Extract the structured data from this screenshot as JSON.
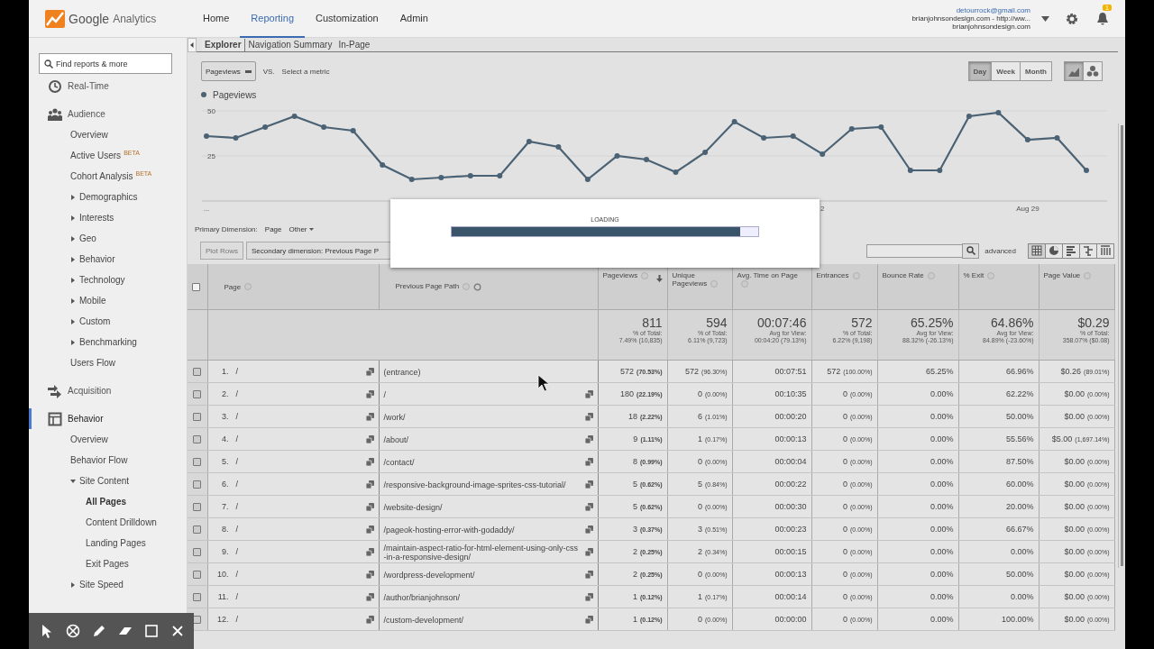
{
  "header": {
    "logo": {
      "brand": "Google",
      "product": "Analytics"
    },
    "nav": [
      {
        "label": "Home",
        "selected": false
      },
      {
        "label": "Reporting",
        "selected": true
      },
      {
        "label": "Customization",
        "selected": false
      },
      {
        "label": "Admin",
        "selected": false
      }
    ],
    "account": {
      "email": "detourrock@gmail.com",
      "property": "brianjohnsondesign.com - http://ww...",
      "view": "brianjohnsondesign.com"
    },
    "notifications": "1"
  },
  "sidebar": {
    "search": {
      "placeholder": "Find reports & more"
    },
    "sections": [
      {
        "label": "Real-Time",
        "kind": "realtime",
        "selected": false
      },
      {
        "label": "Audience",
        "kind": "audience",
        "selected": false,
        "items": [
          {
            "label": "Overview",
            "selected": false
          },
          {
            "label": "Active Users",
            "badge": "BETA",
            "selected": false
          },
          {
            "label": "Cohort Analysis",
            "badge": "BETA",
            "selected": false
          },
          {
            "label": "Demographics",
            "expanded": false,
            "selected": false
          },
          {
            "label": "Interests",
            "expanded": false,
            "selected": false
          },
          {
            "label": "Geo",
            "expanded": false,
            "selected": false
          },
          {
            "label": "Behavior",
            "expanded": false,
            "selected": false
          },
          {
            "label": "Technology",
            "expanded": false,
            "selected": false
          },
          {
            "label": "Mobile",
            "expanded": false,
            "selected": false
          },
          {
            "label": "Custom",
            "expanded": false,
            "selected": false
          },
          {
            "label": "Benchmarking",
            "expanded": false,
            "selected": false
          },
          {
            "label": "Users Flow",
            "selected": false
          }
        ]
      },
      {
        "label": "Acquisition",
        "kind": "acquisition",
        "selected": false
      },
      {
        "label": "Behavior",
        "kind": "behavior",
        "selected": true,
        "items": [
          {
            "label": "Overview",
            "selected": false
          },
          {
            "label": "Behavior Flow",
            "selected": false
          },
          {
            "label": "Site Content",
            "expanded": true,
            "selected": false,
            "children": [
              {
                "label": "All Pages",
                "selected": true
              },
              {
                "label": "Content Drilldown",
                "selected": false
              },
              {
                "label": "Landing Pages",
                "selected": false
              },
              {
                "label": "Exit Pages",
                "selected": false
              }
            ]
          },
          {
            "label": "Site Speed",
            "expanded": false,
            "selected": false
          }
        ]
      }
    ]
  },
  "report": {
    "tabs": [
      {
        "label": "Explorer",
        "selected": true
      },
      {
        "label": "Navigation Summary",
        "selected": false
      },
      {
        "label": "In-Page",
        "selected": false
      }
    ],
    "metric": {
      "primary": "Pageviews",
      "vs": "VS.",
      "secondary": "Select a metric"
    },
    "periods": [
      {
        "label": "Day",
        "selected": true
      },
      {
        "label": "Week",
        "selected": false
      },
      {
        "label": "Month",
        "selected": false
      }
    ],
    "chart_types": [
      {
        "kind": "line",
        "selected": true
      },
      {
        "kind": "motion",
        "selected": false
      }
    ],
    "chart_data": {
      "type": "line",
      "yticks": [
        25,
        50
      ],
      "ylim": [
        0,
        50
      ],
      "categories": [
        "...",
        null,
        null,
        null,
        null,
        null,
        null,
        null,
        null,
        null,
        null,
        null,
        null,
        null,
        null,
        null,
        null,
        null,
        null,
        null,
        null,
        "2",
        null,
        null,
        null,
        null,
        null,
        null,
        "Aug 29",
        null,
        null
      ],
      "series": [
        {
          "name": "Pageviews",
          "color": "#4a6274",
          "marker": "circle",
          "values": [
            36,
            35,
            41,
            47,
            41,
            39,
            20,
            12,
            13,
            14,
            14,
            33,
            30,
            12,
            25,
            23,
            16,
            27,
            44,
            35,
            36,
            26,
            40,
            41,
            17,
            17,
            47,
            49,
            34,
            35,
            17
          ]
        }
      ]
    },
    "loading": {
      "label": "LOADING",
      "level": 0.94
    },
    "dimension": {
      "label": "Primary Dimension:",
      "value": "Page",
      "other": "Other"
    },
    "plot_rows": "Plot Rows",
    "secondary_dimension": "Secondary dimension: Previous Page P",
    "advanced": "advanced",
    "views": [
      {
        "kind": "table",
        "selected": true
      },
      {
        "kind": "pie",
        "selected": false
      },
      {
        "kind": "performance",
        "selected": false
      },
      {
        "kind": "comparison",
        "selected": false
      },
      {
        "kind": "pivot",
        "selected": false
      }
    ],
    "table": {
      "select_all": {
        "checked": false
      },
      "columns": [
        {
          "label": "Page"
        },
        {
          "label": "Previous Page Path"
        },
        {
          "label": "Pageviews",
          "sorted": true
        },
        {
          "label": "Unique Pageviews"
        },
        {
          "label": "Avg. Time on Page"
        },
        {
          "label": "Entrances"
        },
        {
          "label": "Bounce Rate"
        },
        {
          "label": "% Exit"
        },
        {
          "label": "Page Value"
        }
      ],
      "totals": [
        {
          "value": "811",
          "caption": "% of Total:",
          "detail": "7.49% (10,835)"
        },
        {
          "value": "594",
          "caption": "% of Total:",
          "detail": "6.11% (9,723)"
        },
        {
          "value": "00:07:46",
          "caption": "Avg for View:",
          "detail": "00:04:20 (79.13%)"
        },
        {
          "value": "572",
          "caption": "% of Total:",
          "detail": "6.22% (9,198)"
        },
        {
          "value": "65.25%",
          "caption": "Avg for View:",
          "detail": "88.32% (-26.13%)"
        },
        {
          "value": "64.86%",
          "caption": "Avg for View:",
          "detail": "84.89% (-23.60%)"
        },
        {
          "value": "$0.29",
          "caption": "% of Total:",
          "detail": "358.07% ($0.08)"
        }
      ],
      "rows": [
        {
          "checked": false,
          "index": "1.",
          "page": "/",
          "previous": "(entrance)",
          "previous_link": false,
          "metrics": [
            [
              "572",
              "(70.53%)"
            ],
            [
              "572",
              "(96.30%)"
            ],
            [
              "00:07:51"
            ],
            [
              "572",
              "(100.00%)"
            ],
            [
              "65.25%"
            ],
            [
              "66.96%"
            ],
            [
              "$0.26",
              "(89.01%)"
            ]
          ]
        },
        {
          "checked": false,
          "index": "2.",
          "page": "/",
          "previous": "/",
          "previous_link": true,
          "metrics": [
            [
              "180",
              "(22.19%)"
            ],
            [
              "0",
              "(0.00%)"
            ],
            [
              "00:10:35"
            ],
            [
              "0",
              "(0.00%)"
            ],
            [
              "0.00%"
            ],
            [
              "62.22%"
            ],
            [
              "$0.00",
              "(0.00%)"
            ]
          ]
        },
        {
          "checked": false,
          "index": "3.",
          "page": "/",
          "previous": "/work/",
          "previous_link": true,
          "metrics": [
            [
              "18",
              "(2.22%)"
            ],
            [
              "6",
              "(1.01%)"
            ],
            [
              "00:00:20"
            ],
            [
              "0",
              "(0.00%)"
            ],
            [
              "0.00%"
            ],
            [
              "50.00%"
            ],
            [
              "$0.00",
              "(0.00%)"
            ]
          ]
        },
        {
          "checked": false,
          "index": "4.",
          "page": "/",
          "previous": "/about/",
          "previous_link": true,
          "metrics": [
            [
              "9",
              "(1.11%)"
            ],
            [
              "1",
              "(0.17%)"
            ],
            [
              "00:00:13"
            ],
            [
              "0",
              "(0.00%)"
            ],
            [
              "0.00%"
            ],
            [
              "55.56%"
            ],
            [
              "$5.00",
              "(1,697.14%)"
            ]
          ]
        },
        {
          "checked": false,
          "index": "5.",
          "page": "/",
          "previous": "/contact/",
          "previous_link": true,
          "metrics": [
            [
              "8",
              "(0.99%)"
            ],
            [
              "0",
              "(0.00%)"
            ],
            [
              "00:00:04"
            ],
            [
              "0",
              "(0.00%)"
            ],
            [
              "0.00%"
            ],
            [
              "87.50%"
            ],
            [
              "$0.00",
              "(0.00%)"
            ]
          ]
        },
        {
          "checked": false,
          "index": "6.",
          "page": "/",
          "previous": "/responsive-background-image-sprites-css-tutorial/",
          "previous_link": true,
          "metrics": [
            [
              "5",
              "(0.62%)"
            ],
            [
              "5",
              "(0.84%)"
            ],
            [
              "00:00:22"
            ],
            [
              "0",
              "(0.00%)"
            ],
            [
              "0.00%"
            ],
            [
              "60.00%"
            ],
            [
              "$0.00",
              "(0.00%)"
            ]
          ]
        },
        {
          "checked": false,
          "index": "7.",
          "page": "/",
          "previous": "/website-design/",
          "previous_link": true,
          "metrics": [
            [
              "5",
              "(0.62%)"
            ],
            [
              "0",
              "(0.00%)"
            ],
            [
              "00:00:30"
            ],
            [
              "0",
              "(0.00%)"
            ],
            [
              "0.00%"
            ],
            [
              "20.00%"
            ],
            [
              "$0.00",
              "(0.00%)"
            ]
          ]
        },
        {
          "checked": false,
          "index": "8.",
          "page": "/",
          "previous": "/pageok-hosting-error-with-godaddy/",
          "previous_link": true,
          "metrics": [
            [
              "3",
              "(0.37%)"
            ],
            [
              "3",
              "(0.51%)"
            ],
            [
              "00:00:23"
            ],
            [
              "0",
              "(0.00%)"
            ],
            [
              "0.00%"
            ],
            [
              "66.67%"
            ],
            [
              "$0.00",
              "(0.00%)"
            ]
          ]
        },
        {
          "checked": false,
          "index": "9.",
          "page": "/",
          "previous": "/maintain-aspect-ratio-for-html-element-using-only-css-in-a-responsive-design/",
          "previous_link": true,
          "metrics": [
            [
              "2",
              "(0.25%)"
            ],
            [
              "2",
              "(0.34%)"
            ],
            [
              "00:00:15"
            ],
            [
              "0",
              "(0.00%)"
            ],
            [
              "0.00%"
            ],
            [
              "0.00%"
            ],
            [
              "$0.00",
              "(0.00%)"
            ]
          ]
        },
        {
          "checked": false,
          "index": "10.",
          "page": "/",
          "previous": "/wordpress-development/",
          "previous_link": true,
          "metrics": [
            [
              "2",
              "(0.25%)"
            ],
            [
              "0",
              "(0.00%)"
            ],
            [
              "00:00:13"
            ],
            [
              "0",
              "(0.00%)"
            ],
            [
              "0.00%"
            ],
            [
              "50.00%"
            ],
            [
              "$0.00",
              "(0.00%)"
            ]
          ]
        },
        {
          "checked": false,
          "index": "11.",
          "page": "/",
          "previous": "/author/brianjohnson/",
          "previous_link": true,
          "metrics": [
            [
              "1",
              "(0.12%)"
            ],
            [
              "1",
              "(0.17%)"
            ],
            [
              "00:00:14"
            ],
            [
              "0",
              "(0.00%)"
            ],
            [
              "0.00%"
            ],
            [
              "0.00%"
            ],
            [
              "$0.00",
              "(0.00%)"
            ]
          ]
        },
        {
          "checked": false,
          "index": "12.",
          "page": "/",
          "previous": "/custom-development/",
          "previous_link": true,
          "metrics": [
            [
              "1",
              "(0.12%)"
            ],
            [
              "0",
              "(0.00%)"
            ],
            [
              "00:00:00"
            ],
            [
              "0",
              "(0.00%)"
            ],
            [
              "0.00%"
            ],
            [
              "100.00%"
            ],
            [
              "$0.00",
              "(0.00%)"
            ]
          ]
        }
      ]
    }
  }
}
